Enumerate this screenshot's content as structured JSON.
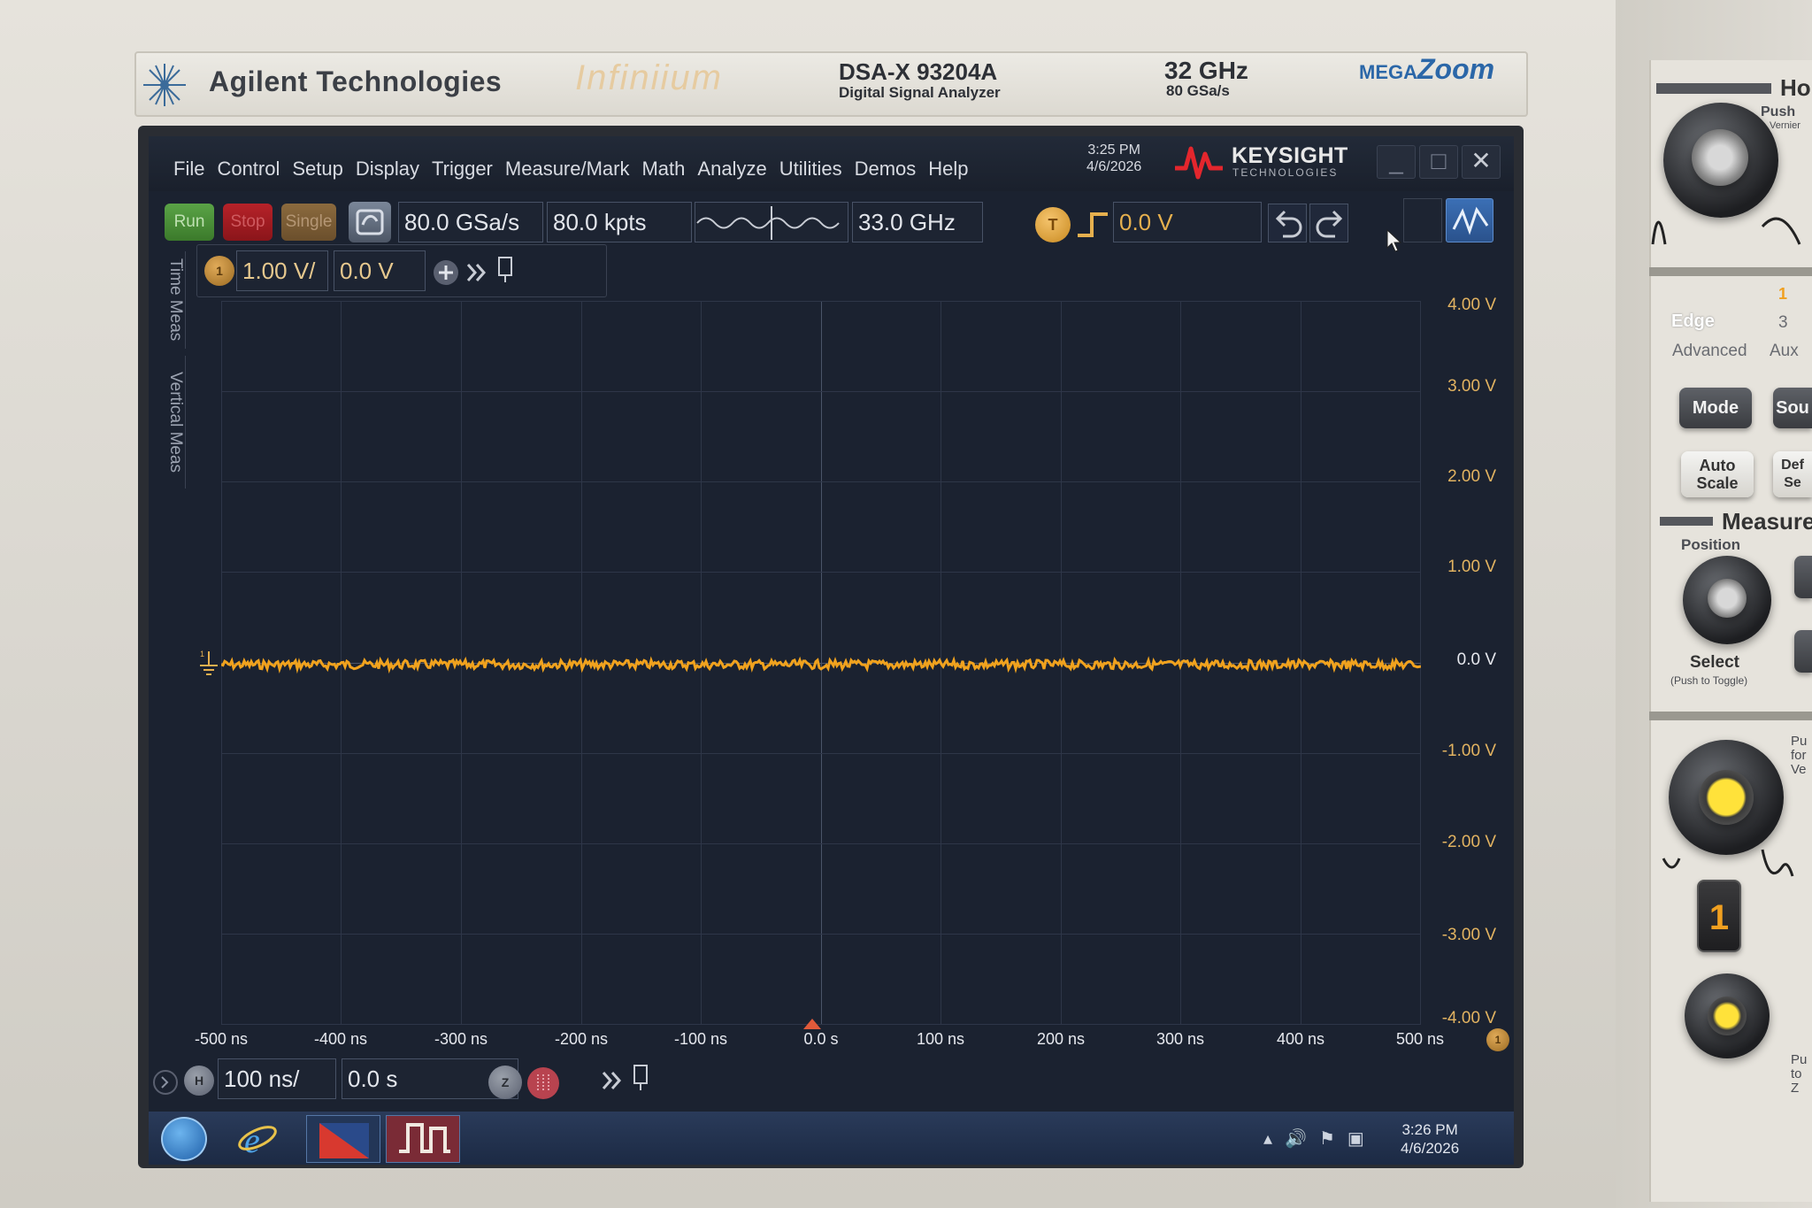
{
  "instrument": {
    "brand": "Agilent Technologies",
    "series": "Infiniium",
    "model": "DSA-X 93204A",
    "model_subtitle": "Digital Signal Analyzer",
    "bandwidth": "32 GHz",
    "sample_rate_spec": "80 GSa/s",
    "zoom_logo": "MEGA",
    "zoom_logo_rest": "Zoom"
  },
  "menubar": {
    "items": [
      "File",
      "Control",
      "Setup",
      "Display",
      "Trigger",
      "Measure/Mark",
      "Math",
      "Analyze",
      "Utilities",
      "Demos",
      "Help"
    ],
    "time": "3:25 PM",
    "date": "4/6/2026",
    "logo_name": "KEYSIGHT",
    "logo_sub": "TECHNOLOGIES"
  },
  "toolbar": {
    "run_label": "Run",
    "stop_label": "Stop",
    "single_label": "Single",
    "sample_rate": "80.0 GSa/s",
    "memory_depth": "80.0 kpts",
    "bandwidth": "33.0 GHz",
    "trigger_badge": "T",
    "trigger_level": "0.0 V"
  },
  "side_tabs": [
    "Time Meas",
    "Vertical Meas"
  ],
  "channel1": {
    "badge": "1",
    "scale": "1.00 V/",
    "offset": "0.0 V"
  },
  "plot": {
    "y_labels": [
      "4.00 V",
      "3.00 V",
      "2.00 V",
      "1.00 V",
      "0.0 V",
      "-1.00 V",
      "-2.00 V",
      "-3.00 V",
      "-4.00 V"
    ],
    "x_labels": [
      "-500 ns",
      "-400 ns",
      "-300 ns",
      "-200 ns",
      "-100 ns",
      "0.0 s",
      "100 ns",
      "200 ns",
      "300 ns",
      "400 ns",
      "500 ns"
    ],
    "trace_color": "#f0a21e",
    "trace_level_v": 0.0,
    "channel_indicator": "1"
  },
  "timebase": {
    "badge": "H",
    "scale": "100 ns/",
    "position": "0.0 s",
    "zoom_badge": "Z"
  },
  "taskbar": {
    "time": "3:26 PM",
    "date": "4/6/2026"
  },
  "front_panel": {
    "horizontal_title": "Ho",
    "push_label": "Push",
    "vernier_label": "Vernier",
    "trigger_source_num": "1",
    "edge_label": "Edge",
    "aux_num": "3",
    "advanced_label": "Advanced",
    "aux_label": "Aux",
    "mode_button": "Mode",
    "source_button": "Sou",
    "auto_scale_button": "Auto Scale",
    "default_setup_button": "Def Se",
    "measure_title": "Measure",
    "position_label": "Position",
    "select_label": "Select",
    "select_sub": "(Push to Toggle)",
    "push_vernier": "Pu for Ve",
    "channel_button": "1",
    "push_to": "Pu to Z"
  }
}
